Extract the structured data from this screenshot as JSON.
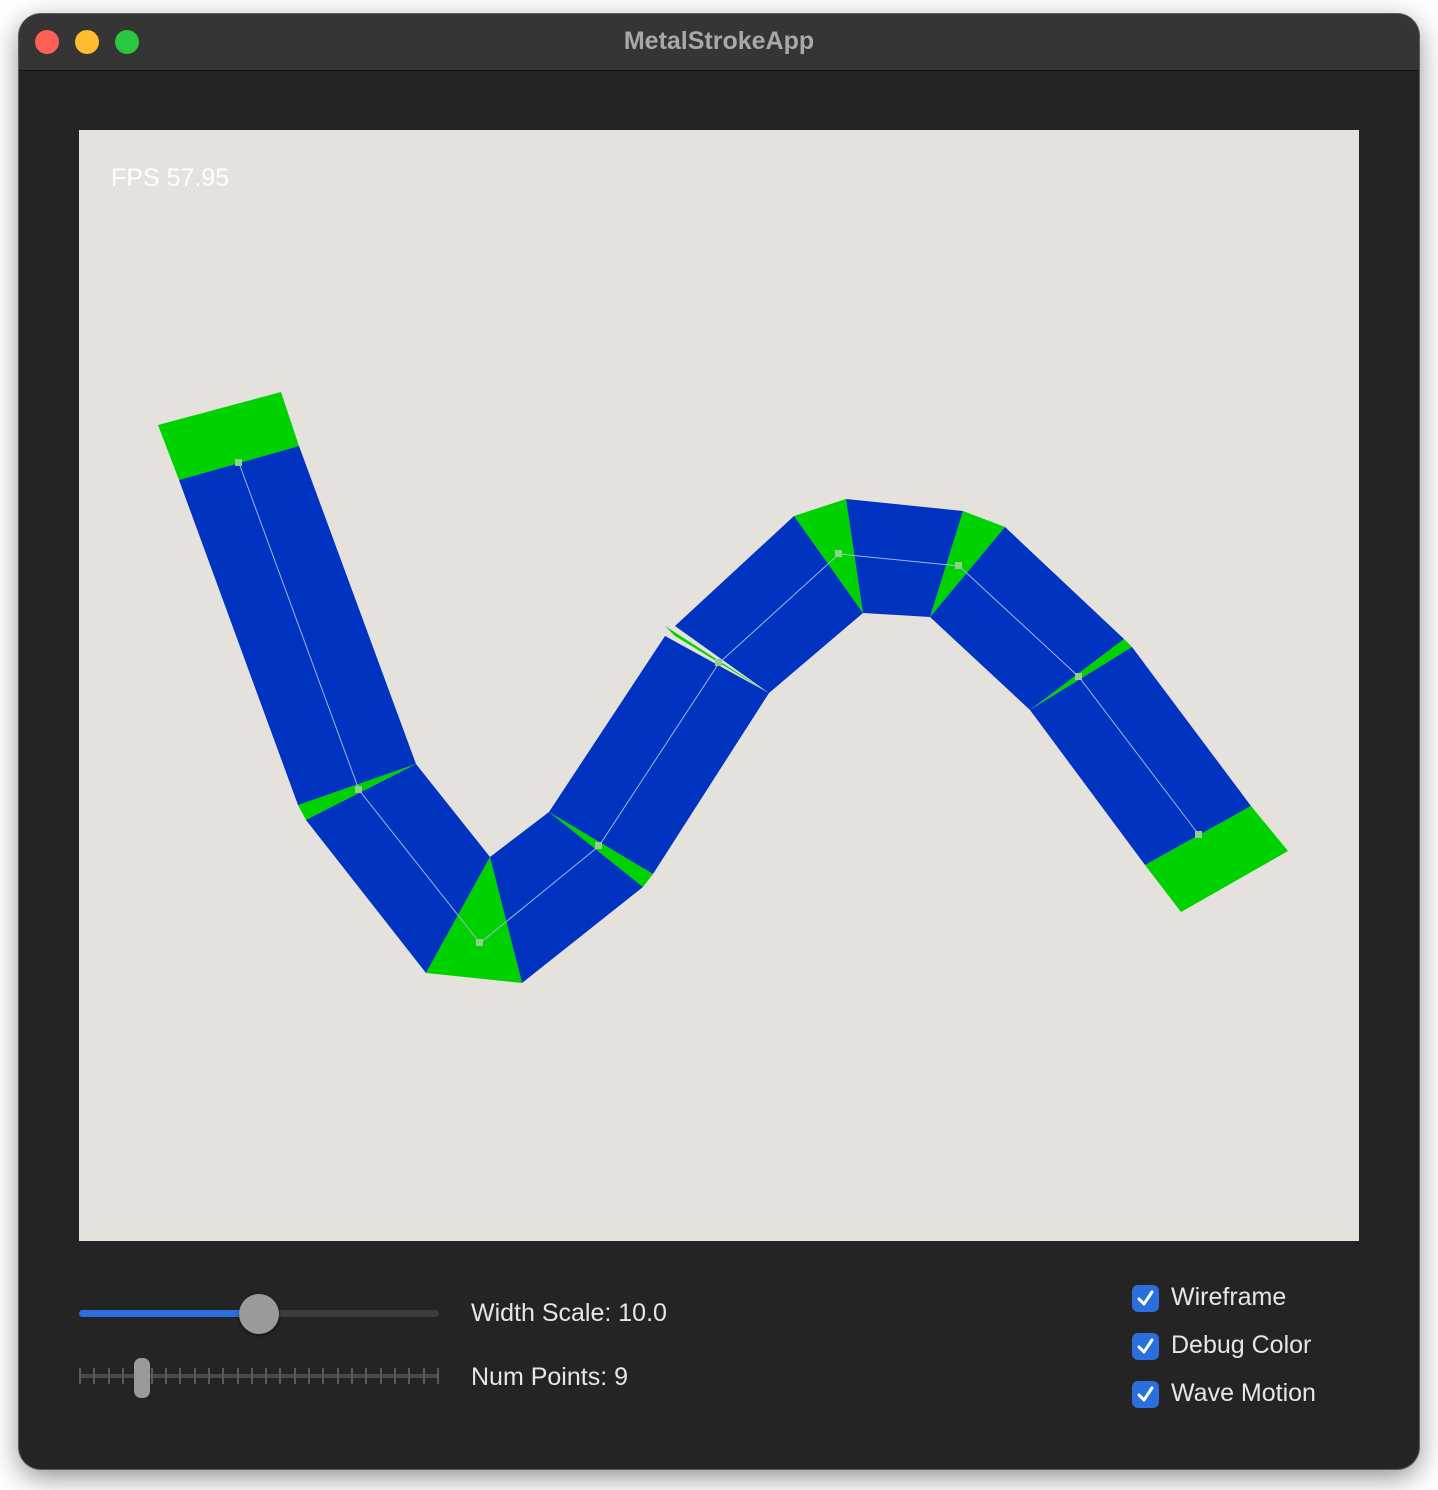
{
  "window": {
    "title": "MetalStrokeApp"
  },
  "canvas": {
    "fps_text": "FPS 57.95",
    "background": "#e5e1dc",
    "stroke_color": "#0033bf",
    "join_color": "#00d200",
    "wireframe_color": "#9fb3e8"
  },
  "controls": {
    "width_scale": {
      "label": "Width Scale: 10.0",
      "value": 10.0,
      "fraction": 0.5,
      "accent": "#2a6fdb"
    },
    "num_points": {
      "label": "Num Points: 9",
      "value": 9,
      "tick_count": 26,
      "fraction": 0.16
    },
    "checkboxes": [
      {
        "label": "Wireframe",
        "checked": true
      },
      {
        "label": "Debug Color",
        "checked": true
      },
      {
        "label": "Wave Motion",
        "checked": true
      }
    ]
  }
}
